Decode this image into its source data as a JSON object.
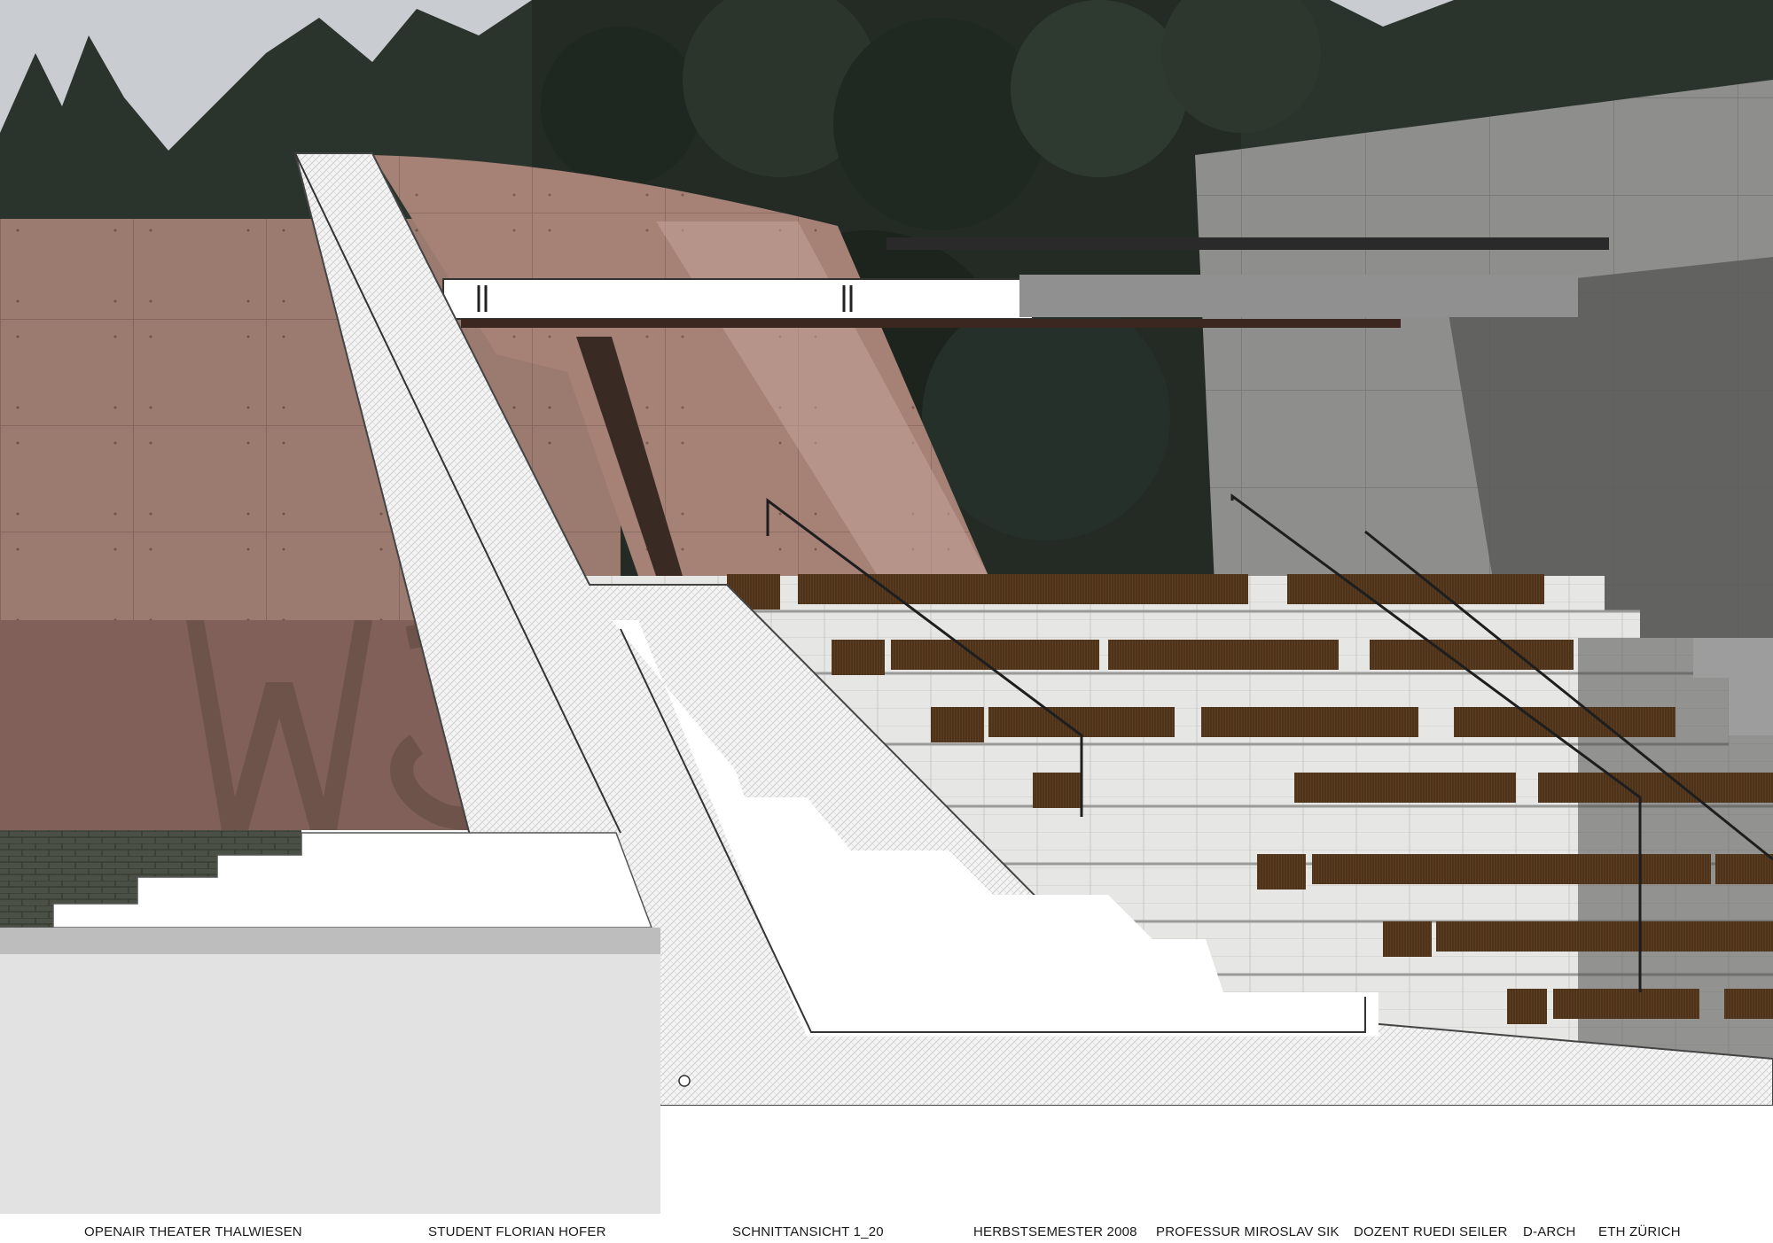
{
  "sheet": {
    "project": "OPENAIR THEATER THALWIESEN",
    "student": "STUDENT FLORIAN HOFER",
    "drawing": "SCHNITTANSICHT 1_20",
    "semester": "HERBSTSEMESTER 2008",
    "professor": "PROFESSUR MIROSLAV SIK",
    "lecturer": "DOZENT RUEDI SEILER",
    "department": "D-ARCH",
    "school": "ETH ZÜRICH"
  },
  "image": {
    "subject": "section-view-architectural-rendering",
    "colors": {
      "sky": "#c9ccd0",
      "trees": "#26302a",
      "pink_concrete": "#9b7a70",
      "gray_concrete": "#8e8e8c",
      "seat_wood": "#5a3c22",
      "section_cut": "#ffffff",
      "ground": "#e2e2e2"
    }
  }
}
